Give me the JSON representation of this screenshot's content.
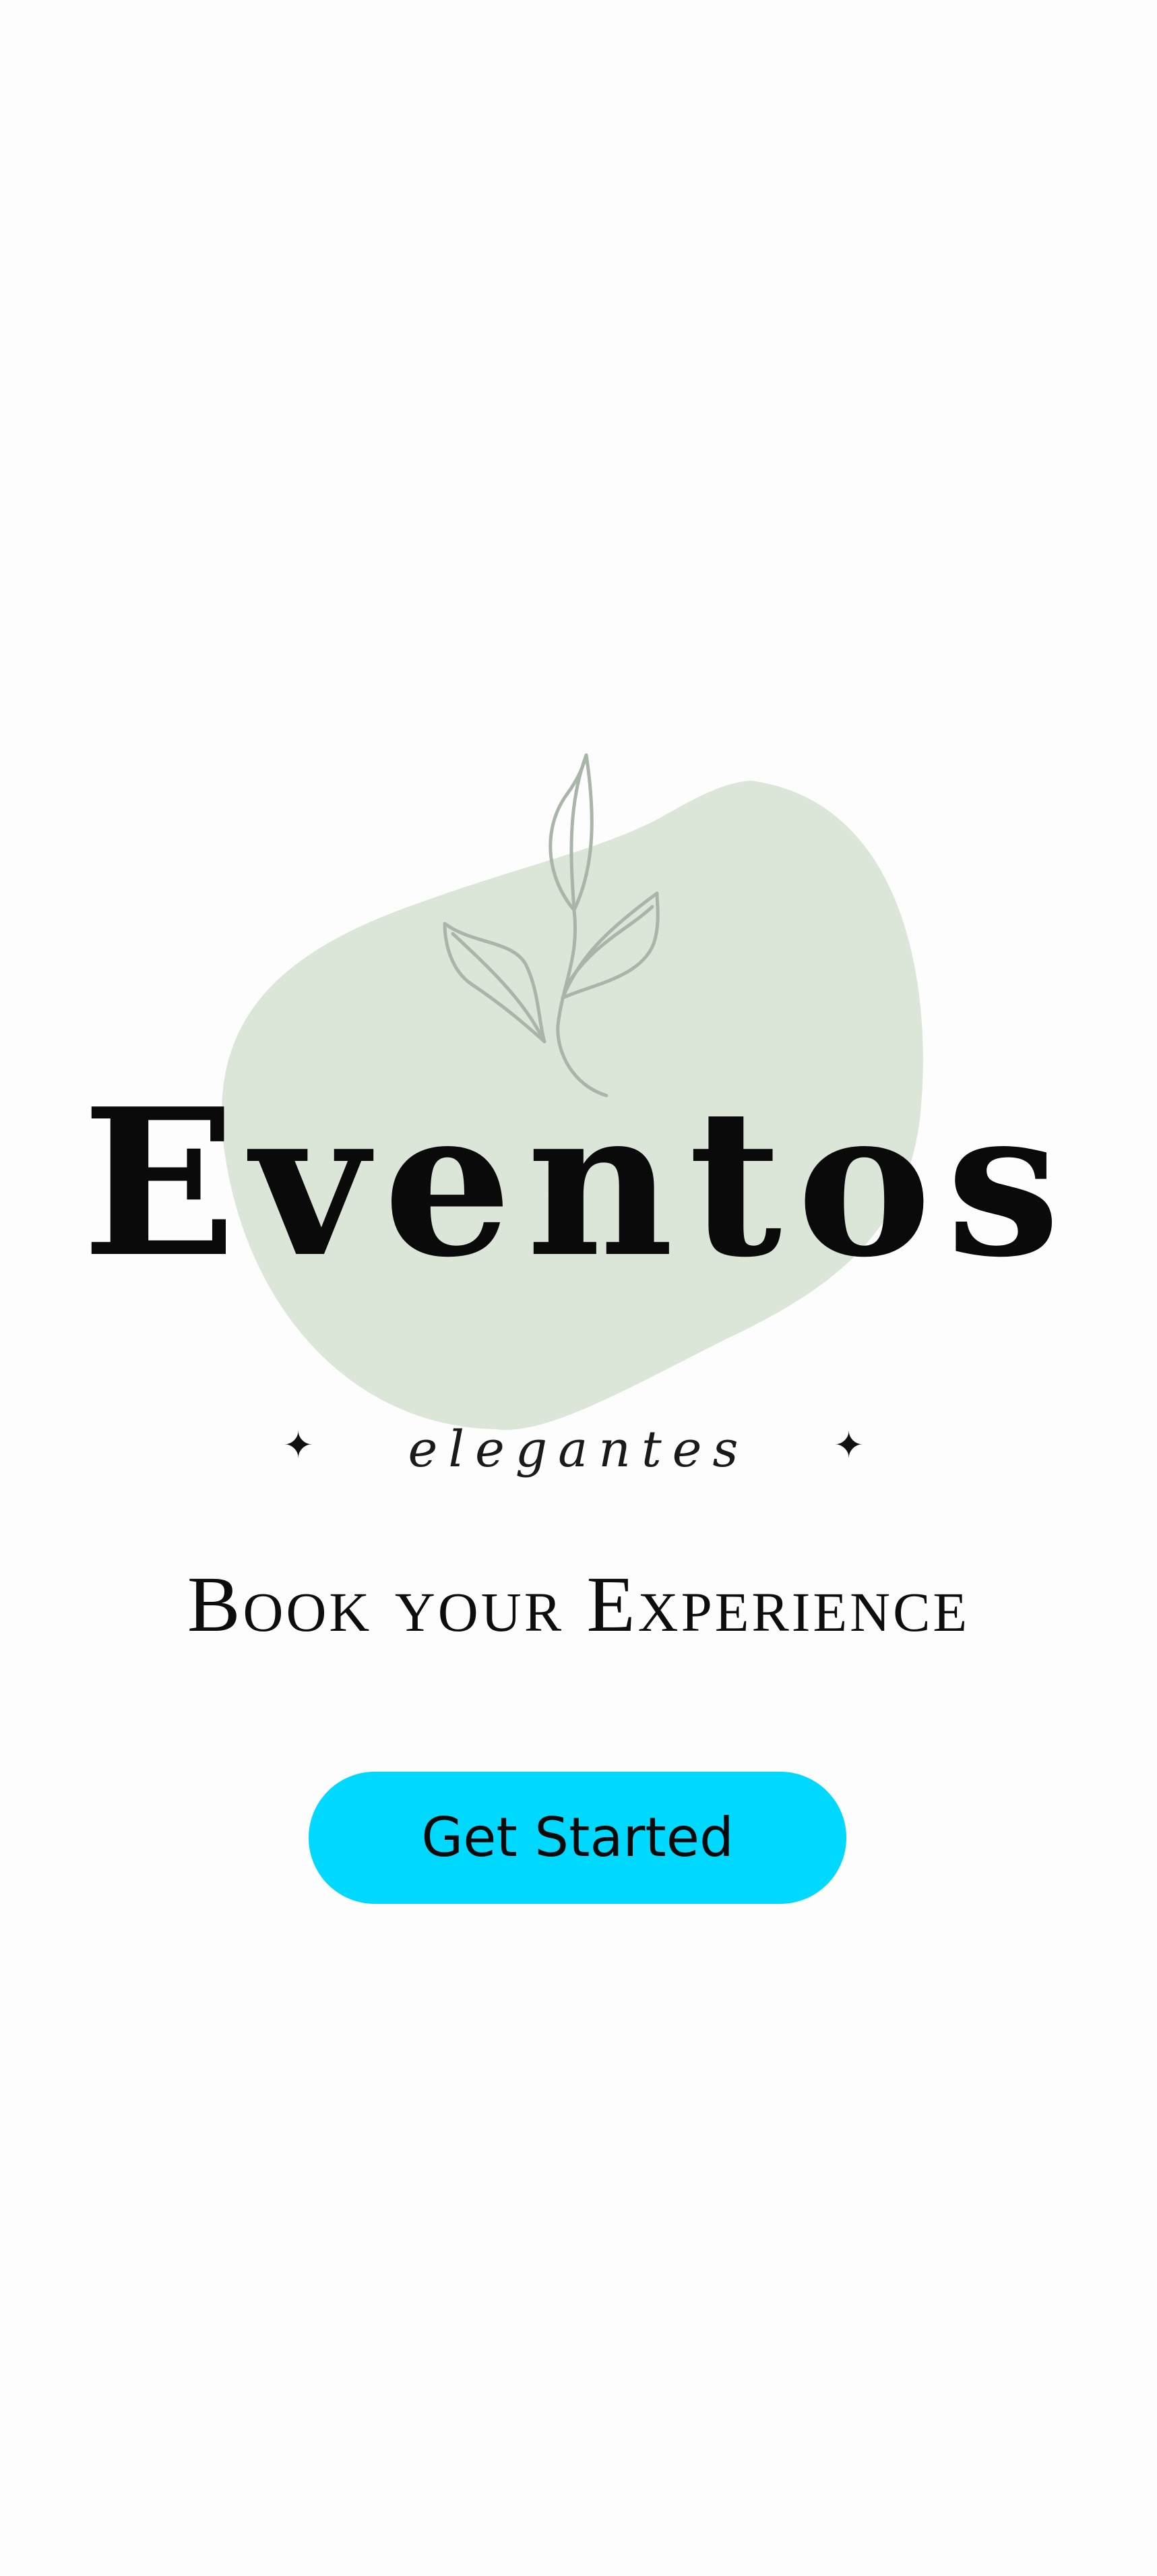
{
  "logo": {
    "wordmark": "Eventos",
    "subtitle": "elegantes",
    "sparkle_glyph": "✦",
    "blob_color": "#dbe5d8",
    "leaf_color": "#a9b5a8",
    "decor_icon": "leaf-branch-icon"
  },
  "tagline": "Book your Experience",
  "cta": {
    "label": "Get Started",
    "color": "#00d9ff"
  }
}
